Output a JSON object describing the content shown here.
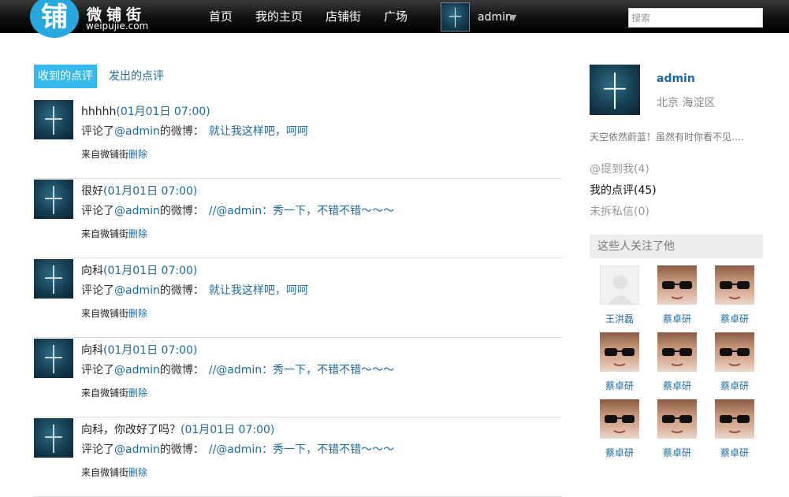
{
  "logo": {
    "mark": "铺",
    "name_cn": "微铺街",
    "domain": "weipujie.com"
  },
  "nav": {
    "items": [
      "首页",
      "我的主页",
      "店铺街",
      "广场"
    ]
  },
  "user": {
    "name": "admin",
    "caret": "▼"
  },
  "search": {
    "placeholder": "搜索"
  },
  "tabs": [
    {
      "label": "收到的点评",
      "active": true
    },
    {
      "label": "发出的点评",
      "active": false
    }
  ],
  "comments": [
    {
      "author": "hhhhh",
      "time": "(01月01日 07:00)",
      "prefix": "评论了",
      "target": "@admin",
      "suffix": "的微博：",
      "content": "就让我这样吧，呵呵",
      "source": "来自微铺街",
      "delete": "删除"
    },
    {
      "author": "很好",
      "time": "(01月01日 07:00)",
      "prefix": "评论了",
      "target": "@admin",
      "suffix": "的微博：",
      "content": "//@admin：秀一下，不错不错～～～",
      "source": "来自微铺街",
      "delete": "删除"
    },
    {
      "author": "向科",
      "time": "(01月01日 07:00)",
      "prefix": "评论了",
      "target": "@admin",
      "suffix": "的微博：",
      "content": "就让我这样吧，呵呵",
      "source": "来自微铺街",
      "delete": "删除"
    },
    {
      "author": "向科",
      "time": "(01月01日 07:00)",
      "prefix": "评论了",
      "target": "@admin",
      "suffix": "的微博：",
      "content": "//@admin：秀一下，不错不错～～～",
      "source": "来自微铺街",
      "delete": "删除"
    },
    {
      "author": "向科，你改好了吗？",
      "time": "(01月01日 07:00)",
      "prefix": "评论了",
      "target": "@admin",
      "suffix": "的微博：",
      "content": "//@admin：秀一下，不错不错～～～",
      "source": "来自微铺街",
      "delete": "删除"
    }
  ],
  "profile": {
    "name": "admin",
    "location": "北京 海淀区",
    "bio": "天空依然蔚蓝！虽然有时你看不见….",
    "links": [
      {
        "label": "@提到我(4)",
        "active": false
      },
      {
        "label": "我的点评(45)",
        "active": true
      },
      {
        "label": "未拆私信(0)",
        "active": false
      }
    ]
  },
  "followers": {
    "title": "这些人关注了他",
    "people": [
      {
        "name": "王洪磊",
        "avatar": "blank-avatar"
      },
      {
        "name": "蔡卓研",
        "avatar": "sunglasses-avatar"
      },
      {
        "name": "蔡卓研",
        "avatar": "sunglasses-avatar"
      },
      {
        "name": "蔡卓研",
        "avatar": "sunglasses-avatar"
      },
      {
        "name": "蔡卓研",
        "avatar": "sunglasses-avatar"
      },
      {
        "name": "蔡卓研",
        "avatar": "sunglasses-avatar"
      },
      {
        "name": "蔡卓研",
        "avatar": "sunglasses-avatar"
      },
      {
        "name": "蔡卓研",
        "avatar": "sunglasses-avatar"
      },
      {
        "name": "蔡卓研",
        "avatar": "sunglasses-avatar"
      }
    ]
  },
  "colors": {
    "link": "#1a6ba0",
    "tab_active": "#36b9ed",
    "logo": "#27a9e0",
    "topbar": "#000000"
  }
}
